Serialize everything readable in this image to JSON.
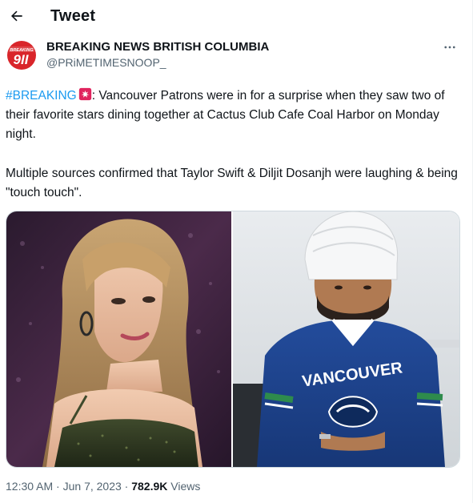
{
  "header": {
    "title": "Tweet",
    "back_icon": "arrow-left-icon"
  },
  "author": {
    "avatar_logo_text": "9II",
    "avatar_logo_subtext": "BREAKING",
    "name": "BREAKING NEWS BRITISH COLUMBIA",
    "handle": "@PRiMETIMESNOOP_",
    "more_icon": "more-dots-icon"
  },
  "tweet": {
    "hashtag": "#BREAKING",
    "emoji": "rotating-light-icon",
    "para1_rest": ":  Vancouver Patrons were in for a surprise when they saw two of their favorite stars dining together at  Cactus Club Cafe Coal Harbor on Monday night.",
    "para2": "Multiple sources confirmed that Taylor Swift & Diljit Dosanjh were laughing & being \"touch touch\".",
    "media": [
      {
        "name": "photo-taylor-swift"
      },
      {
        "name": "photo-diljit-dosanjh",
        "jersey_text": "VANCOUVER"
      }
    ]
  },
  "meta": {
    "time": "12:30 AM",
    "sep1": " · ",
    "date": "Jun 7, 2023",
    "sep2": " · ",
    "views_count": "782.9K",
    "views_label": " Views"
  },
  "colors": {
    "accent": "#1d9bf0",
    "text": "#0f1419",
    "secondary": "#536471",
    "border": "#cfd9de"
  }
}
